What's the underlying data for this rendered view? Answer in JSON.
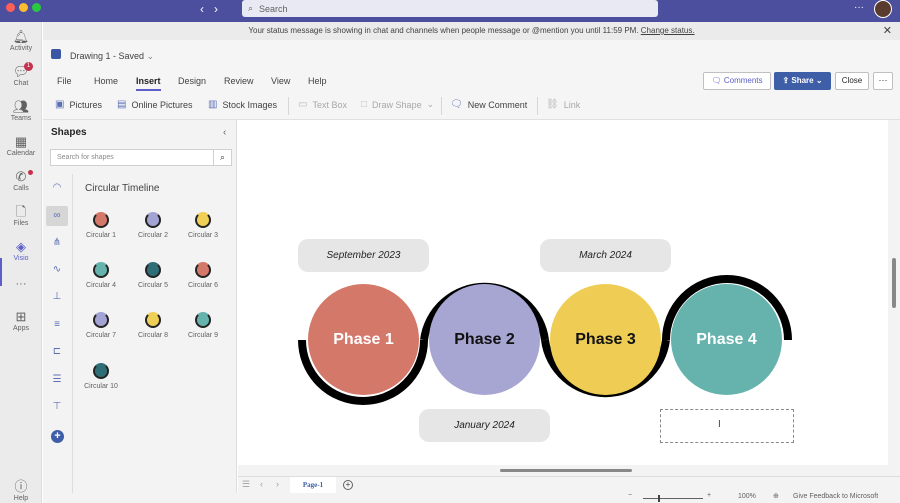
{
  "titlebar": {
    "search_placeholder": "Search",
    "more": "···"
  },
  "rail": [
    {
      "label": "Activity",
      "icon": "bell-icon"
    },
    {
      "label": "Chat",
      "icon": "chat-icon",
      "badge": "1"
    },
    {
      "label": "Teams",
      "icon": "teams-icon"
    },
    {
      "label": "Calendar",
      "icon": "calendar-icon"
    },
    {
      "label": "Calls",
      "icon": "phone-icon"
    },
    {
      "label": "Files",
      "icon": "file-icon"
    },
    {
      "label": "Visio",
      "icon": "visio-icon"
    },
    {
      "label": "···",
      "icon": "more-icon"
    },
    {
      "label": "Apps",
      "icon": "apps-icon"
    },
    {
      "label": "Help",
      "icon": "help-icon"
    }
  ],
  "status_banner": {
    "text": "Your status message is showing in chat and channels when people message or @mention you until 11:59 PM.",
    "link": "Change status."
  },
  "file": {
    "name": "Drawing 1  -  Saved"
  },
  "ribbon": {
    "tabs": [
      "File",
      "Home",
      "Insert",
      "Design",
      "Review",
      "View",
      "Help"
    ],
    "active_tab": "Insert",
    "buttons": {
      "comments": "Comments",
      "share": "Share",
      "close": "Close",
      "more": "···"
    },
    "tools": {
      "pictures": "Pictures",
      "online_pictures": "Online Pictures",
      "stock_images": "Stock Images",
      "text_box": "Text Box",
      "draw_shape": "Draw Shape",
      "new_comment": "New Comment",
      "link": "Link"
    }
  },
  "shapes_panel": {
    "title": "Shapes",
    "search_placeholder": "Search for shapes",
    "category": "Circular Timeline",
    "items": [
      {
        "label": "Circular 1",
        "color": "#d4786a"
      },
      {
        "label": "Circular 2",
        "color": "#a3a3d4"
      },
      {
        "label": "Circular 3",
        "color": "#f0cf56"
      },
      {
        "label": "Circular 4",
        "color": "#66b3ad"
      },
      {
        "label": "Circular 5",
        "color": "#2f6e77"
      },
      {
        "label": "Circular 6",
        "color": "#d4786a"
      },
      {
        "label": "Circular 7",
        "color": "#a3a3d4"
      },
      {
        "label": "Circular 8",
        "color": "#f0cf56"
      },
      {
        "label": "Circular 9",
        "color": "#66b3ad"
      },
      {
        "label": "Circular 10",
        "color": "#2f6e77"
      }
    ]
  },
  "canvas": {
    "phases": [
      {
        "label": "Phase 1",
        "color": "#d4786a"
      },
      {
        "label": "Phase 2",
        "color": "#a7a6d2"
      },
      {
        "label": "Phase 3",
        "color": "#efcd55"
      },
      {
        "label": "Phase 4",
        "color": "#66b3ad"
      }
    ],
    "dates": {
      "top1": "September 2023",
      "top2": "March 2024",
      "bottom1": "January 2024"
    }
  },
  "pagebar": {
    "page": "Page-1"
  },
  "footer": {
    "zoom": "100%",
    "feedback": "Give Feedback to Microsoft"
  }
}
